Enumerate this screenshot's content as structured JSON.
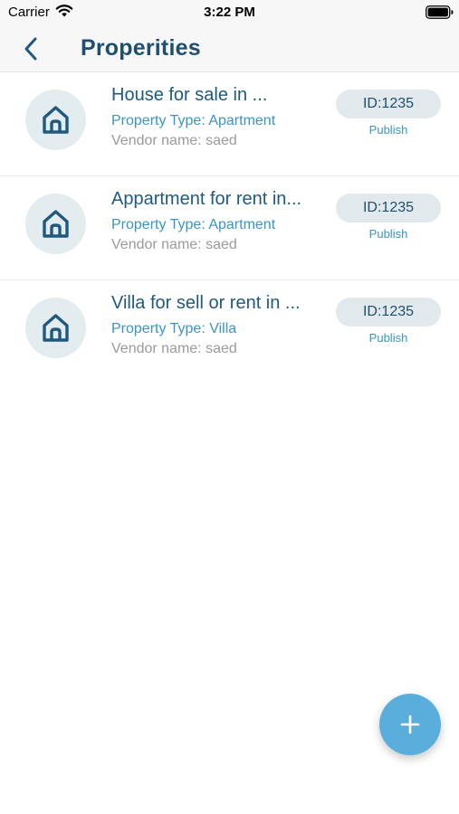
{
  "status_bar": {
    "carrier": "Carrier",
    "time": "3:22 PM"
  },
  "nav": {
    "title": "Properities",
    "back_icon": "chevron-left-icon"
  },
  "properties": [
    {
      "title": "House for sale in ...",
      "type": "Property Type: Apartment",
      "vendor": "Vendor name: saed",
      "id": "ID:1235",
      "status": "Publish",
      "icon": "house-icon"
    },
    {
      "title": "Appartment for rent in...",
      "type": "Property Type: Apartment",
      "vendor": "Vendor name: saed",
      "id": "ID:1235",
      "status": "Publish",
      "icon": "house-icon"
    },
    {
      "title": "Villa for sell or rent in ...",
      "type": "Property Type: Villa",
      "vendor": "Vendor name: saed",
      "id": "ID:1235",
      "status": "Publish",
      "icon": "house-icon"
    }
  ],
  "fab": {
    "icon": "plus-icon"
  },
  "colors": {
    "primary_dark": "#1f4f6e",
    "accent": "#3b95c4",
    "fab": "#5aaedc",
    "badge_bg": "#e2e9ec",
    "avatar_bg": "#e3ecee",
    "muted": "#9a9a9a"
  }
}
